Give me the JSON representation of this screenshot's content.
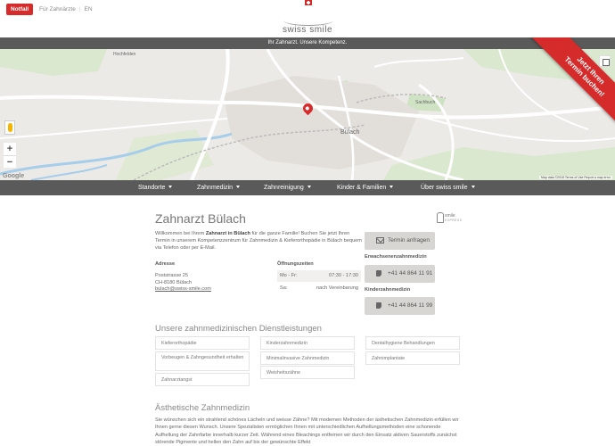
{
  "topbar": {
    "notfall_label": "Notfall",
    "link_zahnaerzte": "Für Zahnärzte",
    "link_lang": "EN",
    "logo_text": "swiss smile"
  },
  "tagline": "Ihr Zahnarzt. Unsere Kompetenz.",
  "ribbon": {
    "line1": "Jetzt Ihren",
    "line2": "Termin buchen!"
  },
  "map": {
    "labels": {
      "hochfelden": "Hochfelden",
      "bulach": "Bülach",
      "sachbuch": "Sachbuch"
    },
    "footer": "Map data ©2018   Terms of Use   Report a map error",
    "google": "Google"
  },
  "nav": [
    {
      "label": "Standorte"
    },
    {
      "label": "Zahnmedizin"
    },
    {
      "label": "Zahnreinigung"
    },
    {
      "label": "Kinder & Familien"
    },
    {
      "label": "Über swiss smile"
    }
  ],
  "content": {
    "title": "Zahnarzt Bülach",
    "intro_pre": "Willkommen bei Ihrem ",
    "intro_bold": "Zahnarzt in Bülach",
    "intro_post": " für die ganze Familie! Buchen Sie jetzt Ihren Termin in unserem Kompetenzzentrum für Zahnmedizin & Kieferorthopädie in Bülach bequem via Telefon oder per E-Mail.",
    "address_label": "Adresse",
    "address_line1": "Poststrasse 25",
    "address_line2": "CH-8180 Bülach",
    "email": "bulach@swiss-smile.com",
    "hours_label": "Öffnungszeiten",
    "hours": [
      {
        "day": "Mo - Fr:",
        "time": "07:30 - 17:30"
      },
      {
        "day": "Sa:",
        "time": "nach Vereinbarung"
      }
    ],
    "badge_line1": "smile",
    "badge_line2": "EXPRESS",
    "termin_button": "Termin anfragen",
    "erwachsenen_label": "Erwachsenenzahnmedizin",
    "phone_adult": "+41 44 864 11 91",
    "kinder_label": "Kinderzahnmedizin",
    "phone_kids": "+41 44 864 11 99",
    "services_title": "Unsere zahnmedizinischen Dienstleistungen",
    "services_col1": [
      "Kieferorthopädie",
      "Vorbeugen & Zahngesundheit erhalten",
      "Zahnarztangst"
    ],
    "services_col2": [
      "Kinderzahnmedizin",
      "Minimalinvasive Zahnmedizin",
      "Weisheitszähne"
    ],
    "services_col3": [
      "Dentalhygiene Behandlungen",
      "Zahnimplantate"
    ],
    "aesthetic_title": "Ästhetische Zahnmedizin",
    "aesthetic_text": "Sie wünschen sich ein strahlend schönes Lächeln und weisse Zähne? Mit modernen Methoden der ästhetischen Zahnmedizin erfüllen wir Ihnen gerne diesen Wunsch. Unsere Spezialisten ermöglichen Ihnen mit unterschiedlichen Aufhellungsmethoden eine schonende Aufhellung der Zahnfarbe innerhalb kurzer Zeit. Während eines Bleachings entfernen wir durch den Einsatz aktiven Sauerstoffs zunächst störende Pigmente und hellen den Zahn auf bis der gewünschte Effekt"
  }
}
